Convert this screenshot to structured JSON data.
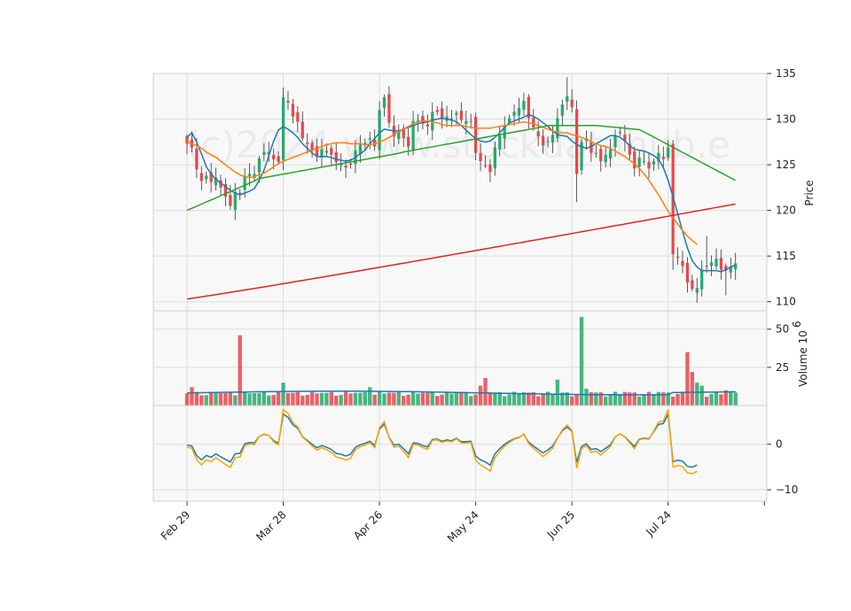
{
  "chart_data": {
    "type": "candlestick",
    "watermark": "(c)2024 www.stockdatahub.e",
    "x_tick_labels": [
      "Feb 29",
      "Mar 28",
      "Apr 26",
      "May 24",
      "Jun 25",
      "Jul 24"
    ],
    "x_tick_index": [
      0,
      20,
      40,
      60,
      80,
      100
    ],
    "x_range": [
      -7,
      120.5
    ],
    "colors": {
      "up": "#26a96c",
      "down": "#e8474b",
      "ma_fast": "#1f77b4",
      "ma_mid": "#ff7f0e",
      "ma_slow": "#2ca02c",
      "ma_long": "#d62728",
      "vol_ma": "#1f77b4",
      "osc_a": "#1f77b4",
      "osc_b": "#ffa500",
      "panel_bg": "#f8f8f8",
      "grid": "#dddddd"
    },
    "price_panel": {
      "ylabel": "Price",
      "ylim": [
        109,
        135
      ],
      "yticks": [
        110,
        115,
        120,
        125,
        130,
        135
      ],
      "closes": [
        127.3,
        126.9,
        124.5,
        123.2,
        123.8,
        123.1,
        123.6,
        122.5,
        121.5,
        120.5,
        122.0,
        121.8,
        123.8,
        124.0,
        124.0,
        125.7,
        126.4,
        126.4,
        125.6,
        125.3,
        132.4,
        131.8,
        130.3,
        129.7,
        127.9,
        127.3,
        126.6,
        126.0,
        126.7,
        126.5,
        126.1,
        125.3,
        125.1,
        124.7,
        125.0,
        126.6,
        127.2,
        127.4,
        127.9,
        127.0,
        131.0,
        132.4,
        129.6,
        128.1,
        128.6,
        127.9,
        127.0,
        129.8,
        129.9,
        129.5,
        129.2,
        130.8,
        130.8,
        130.1,
        130.3,
        130.1,
        130.7,
        129.9,
        129.8,
        129.8,
        126.3,
        125.4,
        124.9,
        124.2,
        126.9,
        128.2,
        129.3,
        130.1,
        130.8,
        131.2,
        132.0,
        130.1,
        129.1,
        128.1,
        127.1,
        127.6,
        128.3,
        130.1,
        131.6,
        132.5,
        131.3,
        124.0,
        127.5,
        127.9,
        126.3,
        126.3,
        125.4,
        126.1,
        126.7,
        128.2,
        128.6,
        127.6,
        126.1,
        124.6,
        125.8,
        125.4,
        124.6,
        125.4,
        126.3,
        125.6,
        126.9,
        115.2,
        114.8,
        113.9,
        112.1,
        111.4,
        111.5,
        113.5,
        113.9,
        114.3,
        114.7,
        113.5,
        113.4,
        113.9,
        114.2
      ],
      "ma_fast": [
        128.0,
        128.5,
        127.5,
        126.2,
        124.8,
        124.0,
        123.4,
        123.0,
        122.6,
        122.2,
        121.9,
        121.7,
        121.9,
        122.1,
        122.4,
        123.3,
        124.4,
        126.0,
        127.6,
        128.8,
        129.2,
        128.9,
        128.5,
        128.0,
        127.3,
        126.8,
        126.3,
        125.9,
        125.9,
        125.9,
        125.8,
        125.6,
        125.5,
        125.4,
        125.5,
        125.8,
        126.2,
        126.6,
        127.3,
        127.9,
        128.5,
        128.9,
        128.8,
        128.7,
        128.7,
        128.9,
        129.1,
        129.3,
        129.5,
        129.6,
        129.7,
        129.9,
        130.0,
        130.1,
        130.0,
        129.9,
        129.7,
        129.3,
        128.8,
        128.3,
        127.9,
        127.6,
        127.5,
        127.6,
        128.0,
        128.5,
        129.1,
        129.6,
        129.8,
        130.0,
        130.2,
        130.5,
        130.3,
        130.0,
        129.6,
        129.2,
        128.7,
        128.3,
        128.2,
        128.1,
        127.6,
        127.2,
        127.0,
        126.8,
        127.0,
        127.3,
        127.6,
        127.9,
        128.2,
        128.2,
        128.0,
        127.6,
        127.1,
        126.7,
        126.6,
        126.5,
        126.3,
        126.0,
        125.6,
        124.7,
        123.3,
        121.5,
        119.6,
        117.7,
        115.9,
        114.5,
        113.8,
        113.4,
        113.4,
        113.4,
        113.4,
        113.3,
        113.5,
        113.8,
        114.0
      ],
      "ma_mid": [
        127.5,
        127.3,
        127.1,
        126.8,
        126.4,
        126.1,
        125.8,
        125.4,
        125.0,
        124.6,
        124.2,
        123.9,
        123.7,
        123.6,
        123.7,
        123.9,
        124.1,
        124.4,
        124.8,
        125.1,
        125.4,
        125.6,
        125.8,
        126.0,
        126.2,
        126.4,
        126.6,
        126.8,
        127.0,
        127.2,
        127.3,
        127.4,
        127.4,
        127.4,
        127.3,
        127.3,
        127.3,
        127.2,
        127.2,
        127.3,
        127.5,
        127.7,
        128.0,
        128.3,
        128.6,
        128.9,
        129.2,
        129.5,
        129.7,
        129.8,
        129.8,
        129.7,
        129.6,
        129.4,
        129.3,
        129.3,
        129.3,
        129.3,
        129.2,
        129.1,
        129.0,
        129.0,
        129.0,
        129.0,
        129.1,
        129.2,
        129.3,
        129.4,
        129.5,
        129.6,
        129.7,
        129.6,
        129.5,
        129.3,
        129.1,
        128.9,
        128.7,
        128.6,
        128.5,
        128.5,
        128.3,
        128.2,
        128.0,
        127.8,
        127.5,
        127.3,
        127.1,
        127.0,
        126.8,
        126.5,
        126.2,
        125.9,
        125.5,
        125.1,
        124.6,
        124.0,
        123.3,
        122.5,
        121.7,
        120.8,
        119.9,
        119.2,
        118.5,
        117.8,
        117.2,
        116.7,
        116.3
      ]
    },
    "volume_panel": {
      "ylabel": "Volume",
      "multiplier": "10",
      "multiplier_exponent": "6",
      "ylim": [
        0,
        62
      ],
      "yticks": [
        25,
        50
      ]
    },
    "osc_panel": {
      "ylim": [
        -12.5,
        8.5
      ],
      "yticks": [
        -10,
        0
      ]
    }
  }
}
